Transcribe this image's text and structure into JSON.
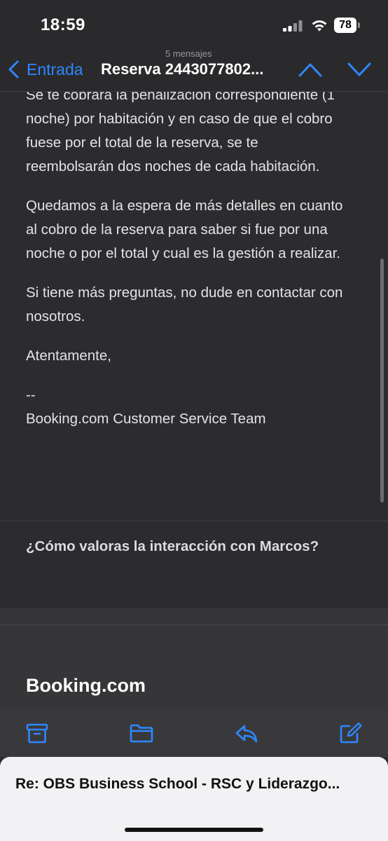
{
  "status_bar": {
    "time": "18:59",
    "battery_level": "78"
  },
  "nav": {
    "back_label": "Entrada",
    "message_count": "5 mensajes",
    "subject": "Reserva 2443077802..."
  },
  "email": {
    "paragraphs": [
      "Se te cobrará la penalización correspondiente (1 noche) por habitación y en caso de que el cobro fuese por el total de la reserva, se te reembolsarán dos noches de cada habitación.",
      "Quedamos a la espera de más detalles en cuanto al cobro de la reserva para saber si fue por una noche o por el total y cual es la gestión a realizar.",
      "Si tiene más preguntas, no dude en contactar con nosotros.",
      "Atentamente,"
    ],
    "signature_sep": "--",
    "signature": "Booking.com Customer Service Team",
    "rating_question": "¿Cómo valoras la interacción con Marcos?",
    "brand": "Booking.com"
  },
  "toolbar": {
    "icons": [
      "archive-icon",
      "folder-icon",
      "reply-icon",
      "compose-icon"
    ]
  },
  "draft": {
    "title": "Re: OBS Business School - RSC y Liderazgo..."
  },
  "colors": {
    "accent": "#2f87ff",
    "background": "#2c2c2e",
    "text": "#e3e3e6"
  }
}
